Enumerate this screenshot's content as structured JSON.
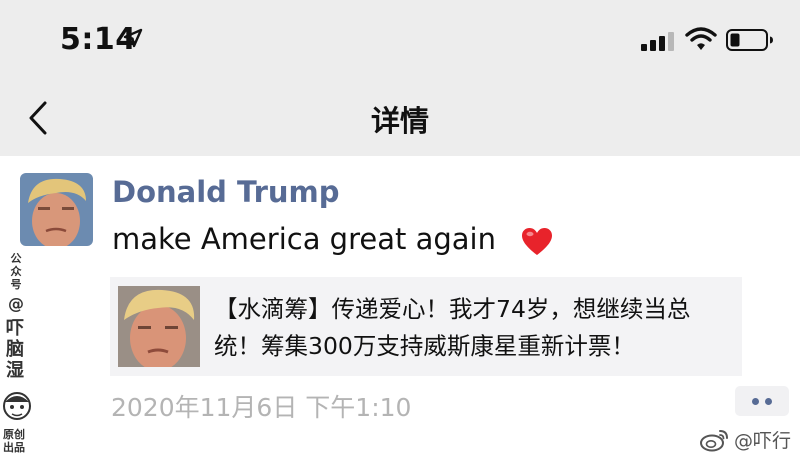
{
  "status_bar": {
    "time": "5:14",
    "location_icon": "location-arrow-icon",
    "signal_icon": "cellular-signal-icon",
    "wifi_icon": "wifi-icon",
    "battery_icon": "battery-icon"
  },
  "nav": {
    "title": "详情",
    "back_icon": "chevron-left-icon"
  },
  "moment": {
    "author": "Donald Trump",
    "text": "make America great again",
    "emoji": "heart-icon",
    "link": {
      "text": "【水滴筹】传递爱心！我才74岁，想继续当总统！筹集300万支持威斯康星重新计票！"
    },
    "timestamp": "2020年11月6日 下午1:10",
    "more_icon": "two-dots-icon"
  },
  "watermarks": {
    "side_top": "公众号",
    "side_at": "@",
    "side_name": [
      "吓",
      "脑",
      "湿"
    ],
    "side_bottom": [
      "原创",
      "出品"
    ],
    "weibo": "@吓行"
  },
  "colors": {
    "nav_background": "#ededed",
    "author_link": "#576b95",
    "timestamp": "#b4b4b4",
    "link_card": "#f3f3f5",
    "heart": "#e8232b"
  }
}
